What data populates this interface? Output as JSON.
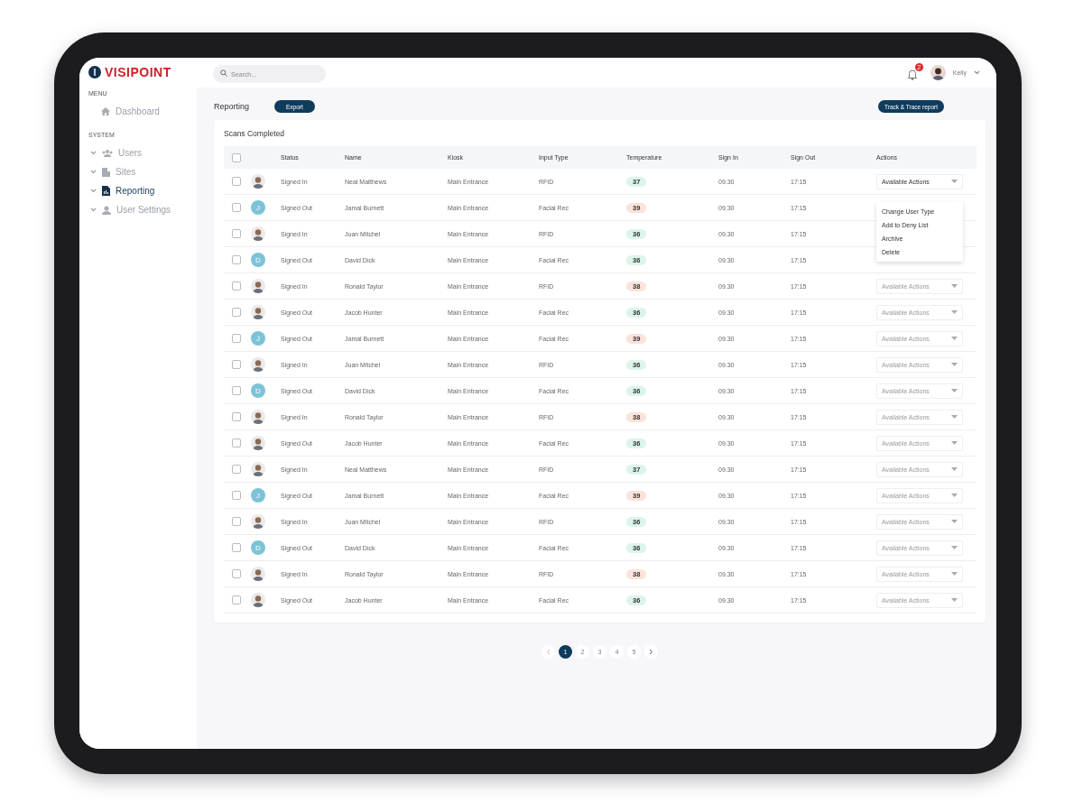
{
  "brand": {
    "name": "VISIPOINT"
  },
  "sidebar": {
    "sections": [
      {
        "title": "MENU",
        "items": [
          {
            "label": "Dashboard",
            "kind": "link",
            "selected": false
          }
        ]
      },
      {
        "title": "SYSTEM",
        "items": [
          {
            "label": "Users",
            "kind": "group",
            "selected": false
          },
          {
            "label": "Sites",
            "kind": "group",
            "selected": false
          },
          {
            "label": "Reporting",
            "kind": "group",
            "selected": true
          },
          {
            "label": "User Settings",
            "kind": "group",
            "selected": false
          }
        ]
      }
    ]
  },
  "topbar": {
    "search": {
      "placeholder": "Search..."
    },
    "notifications": "2",
    "user": {
      "name": "Kelly"
    }
  },
  "page": {
    "title": "Reporting",
    "export_button": "Export",
    "report_button": "Track & Trace report"
  },
  "table": {
    "title": "Scans Completed",
    "all_checked": false,
    "columns": [
      "Status",
      "Name",
      "Kiosk",
      "Input Type",
      "Temperature",
      "Sign In",
      "Sign Out",
      "Actions"
    ],
    "rows": [
      {
        "checked": false,
        "avatar": {
          "kind": "photo"
        },
        "status": "Signed In",
        "name": "Neal Matthews",
        "kiosk": "Main Entrance",
        "input": "RFID",
        "temp": "37",
        "alert": false,
        "sign_in": "09.30",
        "sign_out": "17:15",
        "action": "Available Actions",
        "open": true
      },
      {
        "checked": false,
        "avatar": {
          "kind": "initial",
          "letter": "J"
        },
        "status": "Signed Out",
        "name": "Jamal Burnett",
        "kiosk": "Main Entrance",
        "input": "Facial Rec",
        "temp": "39",
        "alert": true,
        "sign_in": "09.30",
        "sign_out": "17:15"
      },
      {
        "checked": false,
        "avatar": {
          "kind": "photo"
        },
        "status": "Signed In",
        "name": "Juan Mitchel",
        "kiosk": "Main Entrance",
        "input": "RFID",
        "temp": "36",
        "alert": false,
        "sign_in": "09.30",
        "sign_out": "17:15"
      },
      {
        "checked": false,
        "avatar": {
          "kind": "initial",
          "letter": "D"
        },
        "status": "Signed Out",
        "name": "David Dick",
        "kiosk": "Main Entrance",
        "input": "Facial Rec",
        "temp": "36",
        "alert": false,
        "sign_in": "09.30",
        "sign_out": "17:15"
      },
      {
        "checked": false,
        "avatar": {
          "kind": "photo"
        },
        "status": "Signed In",
        "name": "Ronald Taylor",
        "kiosk": "Main Entrance",
        "input": "RFID",
        "temp": "38",
        "alert": true,
        "sign_in": "09.30",
        "sign_out": "17:15",
        "action": "Available Actions",
        "open": false
      },
      {
        "checked": false,
        "avatar": {
          "kind": "photo"
        },
        "status": "Signed Out",
        "name": "Jacob Hunter",
        "kiosk": "Main Entrance",
        "input": "Facial Rec",
        "temp": "36",
        "alert": false,
        "sign_in": "09.30",
        "sign_out": "17:15",
        "action": "Available Actions",
        "open": false
      },
      {
        "checked": false,
        "avatar": {
          "kind": "initial",
          "letter": "J"
        },
        "status": "Signed Out",
        "name": "Jamal Burnett",
        "kiosk": "Main Entrance",
        "input": "Facial Rec",
        "temp": "39",
        "alert": true,
        "sign_in": "09.30",
        "sign_out": "17:15",
        "action": "Available Actions",
        "open": false
      },
      {
        "checked": false,
        "avatar": {
          "kind": "photo"
        },
        "status": "Signed In",
        "name": "Juan Mitchel",
        "kiosk": "Main Entrance",
        "input": "RFID",
        "temp": "36",
        "alert": false,
        "sign_in": "09.30",
        "sign_out": "17:15",
        "action": "Available Actions",
        "open": false
      },
      {
        "checked": false,
        "avatar": {
          "kind": "initial",
          "letter": "D"
        },
        "status": "Signed Out",
        "name": "David Dick",
        "kiosk": "Main Entrance",
        "input": "Facial Rec",
        "temp": "36",
        "alert": false,
        "sign_in": "09.30",
        "sign_out": "17:15",
        "action": "Available Actions",
        "open": false
      },
      {
        "checked": false,
        "avatar": {
          "kind": "photo"
        },
        "status": "Signed In",
        "name": "Ronald Taylor",
        "kiosk": "Main Entrance",
        "input": "RFID",
        "temp": "38",
        "alert": true,
        "sign_in": "09.30",
        "sign_out": "17:15",
        "action": "Available Actions",
        "open": false
      },
      {
        "checked": false,
        "avatar": {
          "kind": "photo"
        },
        "status": "Signed Out",
        "name": "Jacob Hunter",
        "kiosk": "Main Entrance",
        "input": "Facial Rec",
        "temp": "36",
        "alert": false,
        "sign_in": "09.30",
        "sign_out": "17:15",
        "action": "Available Actions",
        "open": false
      },
      {
        "checked": false,
        "avatar": {
          "kind": "photo"
        },
        "status": "Signed In",
        "name": "Neal Matthews",
        "kiosk": "Main Entrance",
        "input": "RFID",
        "temp": "37",
        "alert": false,
        "sign_in": "09.30",
        "sign_out": "17:15",
        "action": "Available Actions",
        "open": false
      },
      {
        "checked": false,
        "avatar": {
          "kind": "initial",
          "letter": "J"
        },
        "status": "Signed Out",
        "name": "Jamal Burnett",
        "kiosk": "Main Entrance",
        "input": "Facial Rec",
        "temp": "39",
        "alert": true,
        "sign_in": "09.30",
        "sign_out": "17:15",
        "action": "Available Actions",
        "open": false
      },
      {
        "checked": false,
        "avatar": {
          "kind": "photo"
        },
        "status": "Signed In",
        "name": "Juan Mitchel",
        "kiosk": "Main Entrance",
        "input": "RFID",
        "temp": "36",
        "alert": false,
        "sign_in": "09.30",
        "sign_out": "17:15",
        "action": "Available Actions",
        "open": false
      },
      {
        "checked": false,
        "avatar": {
          "kind": "initial",
          "letter": "D"
        },
        "status": "Signed Out",
        "name": "David Dick",
        "kiosk": "Main Entrance",
        "input": "Facial Rec",
        "temp": "36",
        "alert": false,
        "sign_in": "09.30",
        "sign_out": "17:15",
        "action": "Available Actions",
        "open": false
      },
      {
        "checked": false,
        "avatar": {
          "kind": "photo"
        },
        "status": "Signed In",
        "name": "Ronald Taylor",
        "kiosk": "Main Entrance",
        "input": "RFID",
        "temp": "38",
        "alert": true,
        "sign_in": "09.30",
        "sign_out": "17:15",
        "action": "Available Actions",
        "open": false
      },
      {
        "checked": false,
        "avatar": {
          "kind": "photo"
        },
        "status": "Signed Out",
        "name": "Jacob Hunter",
        "kiosk": "Main Entrance",
        "input": "Facial Rec",
        "temp": "36",
        "alert": false,
        "sign_in": "09.30",
        "sign_out": "17:15",
        "action": "Available Actions",
        "open": false
      }
    ],
    "menu": [
      "Change User Type",
      "Add to Deny List",
      "Archive",
      "Delete"
    ]
  },
  "pagination": {
    "pages": [
      {
        "label": "1",
        "selected": true
      },
      {
        "label": "2",
        "selected": false
      },
      {
        "label": "3",
        "selected": false
      },
      {
        "label": "4",
        "selected": false
      },
      {
        "label": "5",
        "selected": false
      }
    ]
  }
}
